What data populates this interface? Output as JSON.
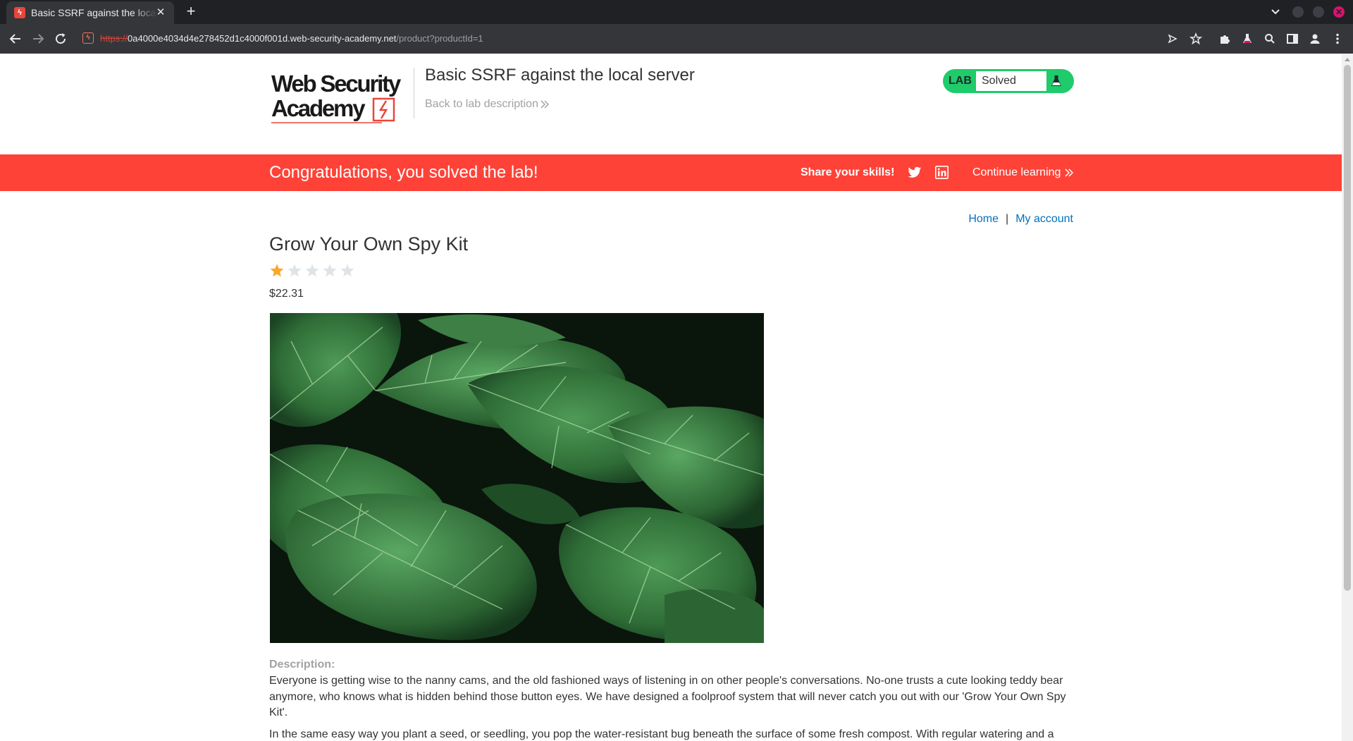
{
  "browser": {
    "tab_title": "Basic SSRF against the local server",
    "url": {
      "scheme": "https://",
      "host": "0a4000e4034d4e278452d1c4000f001d.web-security-academy.net",
      "path": "/product?productId=1"
    }
  },
  "header": {
    "logo_alt": "Web Security Academy",
    "lab_title": "Basic SSRF against the local server",
    "back_link": "Back to lab description",
    "lab_badge_label": "LAB",
    "lab_status": "Solved"
  },
  "banner": {
    "message": "Congratulations, you solved the lab!",
    "share_label": "Share your skills!",
    "continue_link": "Continue learning"
  },
  "nav": {
    "home": "Home",
    "separator": "|",
    "my_account": "My account"
  },
  "product": {
    "title": "Grow Your Own Spy Kit",
    "rating": 1,
    "rating_max": 5,
    "price": "$22.31",
    "description_label": "Description:",
    "description_p1": "Everyone is getting wise to the nanny cams, and the old fashioned ways of listening in on other people's conversations. No-one trusts a cute looking teddy bear anymore, who knows what is hidden behind those button eyes. We have designed a foolproof system that will never catch you out with our 'Grow Your Own Spy Kit'.",
    "description_p2": "In the same easy way you plant a seed, or seedling, you pop the water-resistant bug beneath the surface of some fresh compost. With regular watering and a"
  },
  "colors": {
    "banner": "#ff4237",
    "lab_green": "#1fcb6a",
    "link_blue": "#0071bc",
    "star_filled": "#f9a825",
    "star_empty": "#dfe4e8"
  }
}
